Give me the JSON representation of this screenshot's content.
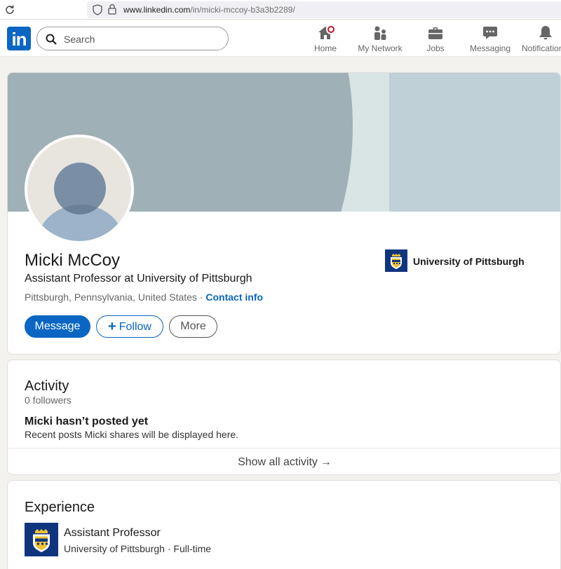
{
  "browser": {
    "url_host": "www.linkedin.com",
    "url_path": "/in/micki-mccoy-b3a3b2289/"
  },
  "nav": {
    "logo_text": "in",
    "search_placeholder": "Search",
    "items": [
      {
        "label": "Home",
        "icon": "home-icon",
        "has_badge": true
      },
      {
        "label": "My Network",
        "icon": "network-icon"
      },
      {
        "label": "Jobs",
        "icon": "briefcase-icon"
      },
      {
        "label": "Messaging",
        "icon": "messaging-icon"
      },
      {
        "label": "Notifications",
        "icon": "bell-icon"
      }
    ]
  },
  "profile": {
    "name": "Micki McCoy",
    "headline": "Assistant Professor at University of Pittsburgh",
    "location": "Pittsburgh, Pennsylvania, United States",
    "separator": " · ",
    "contact_info": "Contact info",
    "buttons": {
      "message": "Message",
      "follow": "Follow",
      "more": "More"
    },
    "organization": "University of Pittsburgh"
  },
  "activity": {
    "title": "Activity",
    "followers": "0 followers",
    "empty_title": "Micki hasn’t posted yet",
    "empty_subtitle": "Recent posts Micki shares will be displayed here.",
    "show_all": "Show all activity"
  },
  "experience": {
    "title": "Experience",
    "items": [
      {
        "role": "Assistant Professor",
        "org_line": "University of Pittsburgh · Full-time"
      }
    ]
  },
  "colors": {
    "brand": "#0a66c2",
    "pitt_navy": "#10357f",
    "pitt_gold": "#f2c230",
    "badge": "#cb112d"
  }
}
